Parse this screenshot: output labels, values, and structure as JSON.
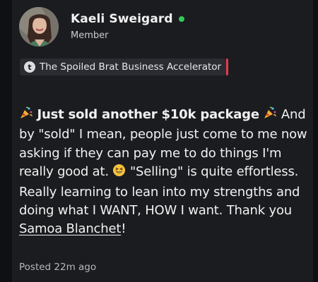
{
  "user": {
    "name": "Kaeli Sweigard",
    "role": "Member",
    "avatar_icon": "profile-photo",
    "online_color": "#34c759"
  },
  "group": {
    "icon_letter": "t",
    "name": "The Spoiled Brat Business Accelerator",
    "accent_color": "#e33b4f"
  },
  "post": {
    "headline": "Just sold another $10k package",
    "text_part1": "And by \"sold\" I mean, people just come to me now asking if they can pay me to do things I'm really good at.",
    "text_part2": "\"Selling\" is quite effortless. Really learning to lean into my strengths and doing what I WANT, HOW I want. Thank you",
    "mention": "Samoa Blanchet",
    "end": "!",
    "emoji_left": "party-popper",
    "emoji_right": "party-popper",
    "emoji_inline": "grinning-squinting-face"
  },
  "meta": {
    "posted": "Posted 22m ago"
  }
}
